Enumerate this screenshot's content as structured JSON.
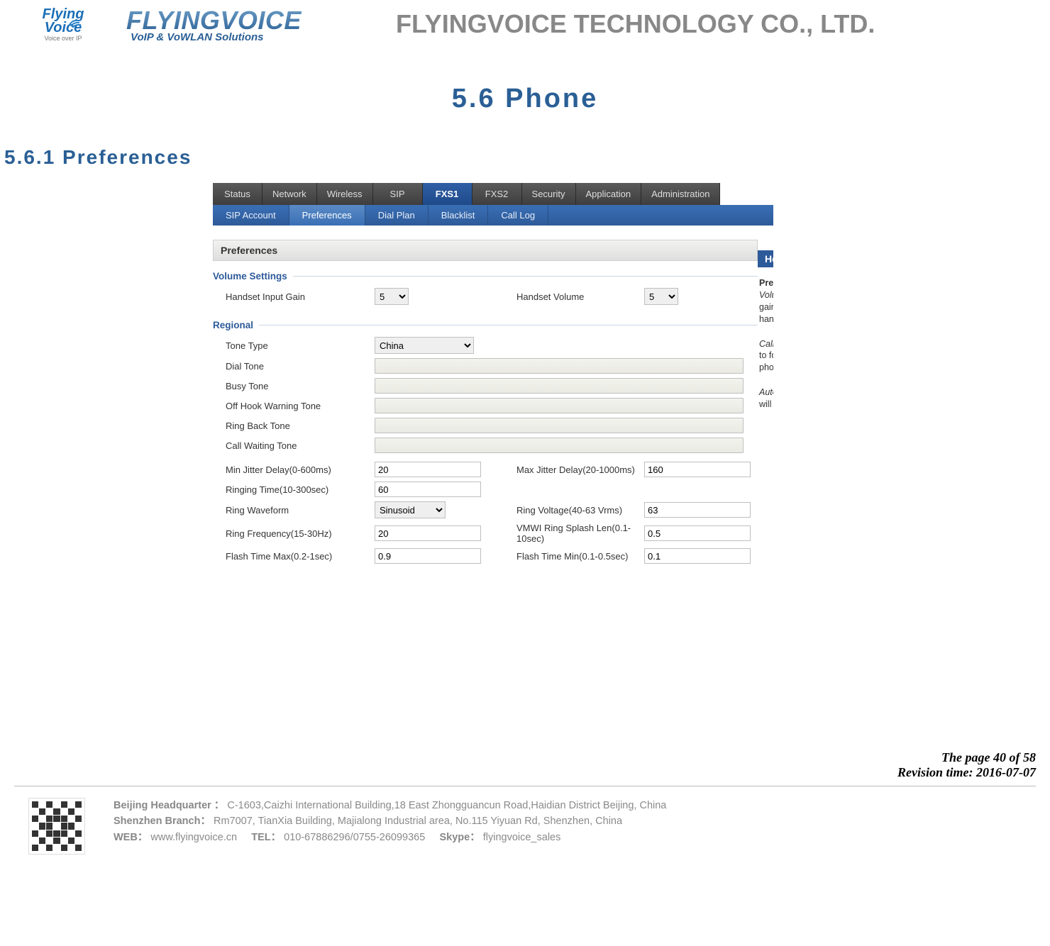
{
  "header": {
    "logo1_line1": "Flying",
    "logo1_line2": "Voice",
    "logo1_tag": "Voice over IP",
    "logo2_main": "FLYINGVOICE",
    "logo2_sub": "VoIP & VoWLAN Solutions",
    "company": "FLYINGVOICE TECHNOLOGY CO., LTD."
  },
  "titles": {
    "section": "5.6  Phone",
    "subsection": "5.6.1 Preferences"
  },
  "topnav": [
    "Status",
    "Network",
    "Wireless",
    "SIP",
    "FXS1",
    "FXS2",
    "Security",
    "Application",
    "Administration"
  ],
  "topnav_active": "FXS1",
  "subnav": [
    "SIP Account",
    "Preferences",
    "Dial Plan",
    "Blacklist",
    "Call Log"
  ],
  "subnav_active": "Preferences",
  "panel_header": "Preferences",
  "groups": {
    "volume": {
      "title": "Volume Settings",
      "handset_input_gain_label": "Handset Input Gain",
      "handset_input_gain_value": "5",
      "handset_volume_label": "Handset Volume",
      "handset_volume_value": "5"
    },
    "regional": {
      "title": "Regional",
      "tone_type_label": "Tone Type",
      "tone_type_value": "China",
      "dial_tone_label": "Dial Tone",
      "busy_tone_label": "Busy Tone",
      "off_hook_label": "Off Hook Warning Tone",
      "ring_back_label": "Ring Back Tone",
      "call_waiting_label": "Call Waiting Tone",
      "min_jitter_label": "Min Jitter Delay(0-600ms)",
      "min_jitter_value": "20",
      "max_jitter_label": "Max Jitter Delay(20-1000ms)",
      "max_jitter_value": "160",
      "ringing_time_label": "Ringing Time(10-300sec)",
      "ringing_time_value": "60",
      "ring_waveform_label": "Ring Waveform",
      "ring_waveform_value": "Sinusoid",
      "ring_voltage_label": "Ring Voltage(40-63 Vrms)",
      "ring_voltage_value": "63",
      "ring_freq_label": "Ring Frequency(15-30Hz)",
      "ring_freq_value": "20",
      "vmwi_label": "VMWI Ring Splash Len(0.1-10sec)",
      "vmwi_value": "0.5",
      "flash_max_label": "Flash Time Max(0.2-1sec)",
      "flash_max_value": "0.9",
      "flash_min_label": "Flash Time Min(0.1-0.5sec)",
      "flash_min_value": "0.1"
    }
  },
  "side": {
    "help": "Help",
    "prefer_h": "Prefer",
    "volume_i": "Volume",
    "gain": "gain or",
    "handse": "handse",
    "callfo_i": "Call Fo",
    "toforw": "to forw",
    "phone": "phone",
    "autoa_i": "Auto A",
    "willbe": "will be"
  },
  "meta": {
    "page": "The page 40 of 58",
    "revision": "Revision time: 2016-07-07"
  },
  "footer": {
    "bj_label": "Beijing Headquarter  ：",
    "bj_addr": "C-1603,Caizhi International Building,18 East Zhongguancun Road,Haidian District Beijing, China",
    "sz_label": "Shenzhen Branch：",
    "sz_addr": "Rm7007, TianXia Building, Majialong Industrial area, No.115 Yiyuan Rd, Shenzhen, China",
    "web_label": "WEB：",
    "web": "www.flyingvoice.cn",
    "tel_label": "TEL：",
    "tel": "010-67886296/0755-26099365",
    "skype_label": "Skype：",
    "skype": "flyingvoice_sales"
  }
}
